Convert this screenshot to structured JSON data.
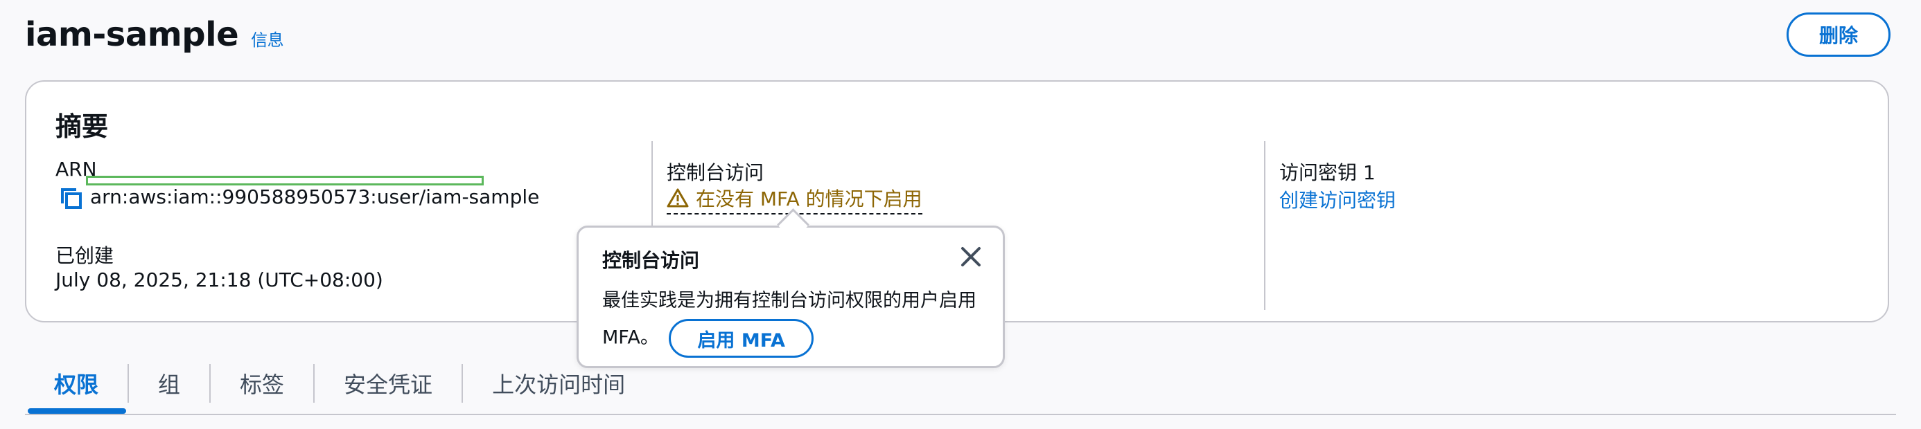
{
  "page": {
    "title": "iam-sample",
    "info_link": "信息",
    "delete_button": "删除"
  },
  "summary": {
    "heading": "摘要",
    "arn_label": "ARN",
    "arn_value": "arn:aws:iam::990588950573:user/iam-sample",
    "created_label": "已创建",
    "created_value": "July 08, 2025, 21:18 (UTC+08:00)",
    "console_label": "控制台访问",
    "console_value": "在没有 MFA 的情况下启用",
    "access_key_label": "访问密钥 1",
    "access_key_link": "创建访问密钥"
  },
  "popover": {
    "title": "控制台访问",
    "body": "最佳实践是为拥有控制台访问权限的用户启用 MFA。",
    "button": "启用 MFA"
  },
  "tabs": [
    {
      "label": "权限",
      "active": true
    },
    {
      "label": "组",
      "active": false
    },
    {
      "label": "标签",
      "active": false
    },
    {
      "label": "安全凭证",
      "active": false
    },
    {
      "label": "上次访问时间",
      "active": false
    }
  ],
  "colors": {
    "accent": "#0972d3",
    "warning": "#8d6605",
    "border": "#c6c6cd",
    "highlight": "#5cb85c"
  },
  "icons": {
    "copy": "copy-icon",
    "warning": "warning-icon",
    "close": "close-icon"
  }
}
